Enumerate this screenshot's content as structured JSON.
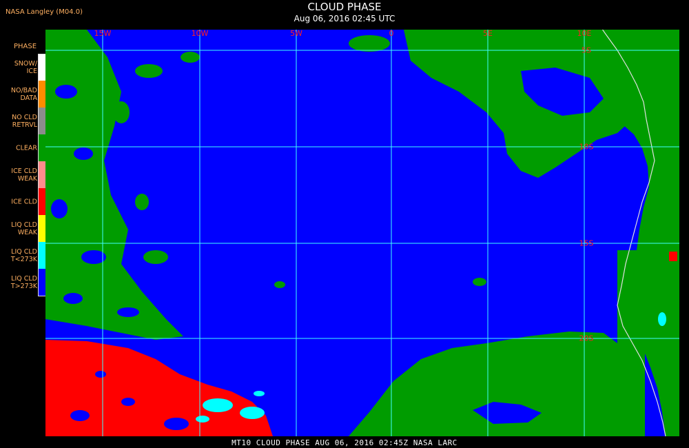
{
  "header": {
    "credit": "NASA Langley (M04.0)",
    "title": "CLOUD PHASE",
    "subtitle": "Aug 06, 2016 02:45 UTC"
  },
  "legend": {
    "title": "PHASE",
    "items": [
      {
        "label": "SNOW/\nICE",
        "color": "#ffffff"
      },
      {
        "label": "NO/BAD\nDATA",
        "color": "#ff8c00"
      },
      {
        "label": "NO CLD\nRETRVL",
        "color": "#8c8c8c"
      },
      {
        "label": "CLEAR",
        "color": "#009c00"
      },
      {
        "label": "ICE CLD\nWEAK",
        "color": "#ff8c8c"
      },
      {
        "label": "ICE CLD",
        "color": "#ff0000"
      },
      {
        "label": "LIQ CLD\nWEAK",
        "color": "#ffff00"
      },
      {
        "label": "LIQ CLD\nT<273K",
        "color": "#00ffff"
      },
      {
        "label": "LIQ CLD\nT>273K",
        "color": "#0000ff"
      }
    ]
  },
  "map": {
    "longitude_labels": [
      "15W",
      "10W",
      "5W",
      "0",
      "5E",
      "10E"
    ],
    "latitude_labels": [
      "5S",
      "10S",
      "15S",
      "20S"
    ],
    "grid_color": "#40ffff",
    "label_color": "#ff2020",
    "coast_color": "#e0e0e0"
  },
  "footer": {
    "text": "MT10   CLOUD PHASE    AUG 06, 2016 02:45Z    NASA LARC"
  }
}
